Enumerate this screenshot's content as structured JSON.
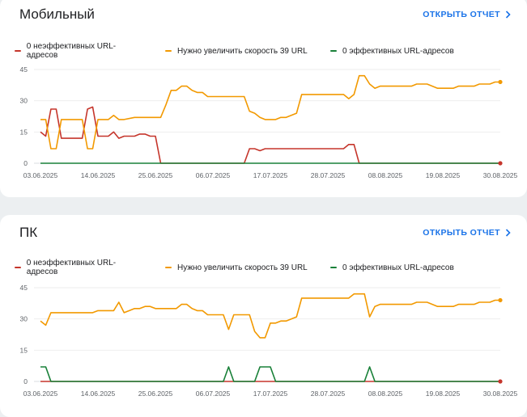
{
  "cards": [
    {
      "title": "Мобильный",
      "link_label": "ОТКРЫТЬ ОТЧЕТ",
      "legend": [
        {
          "label": "0 неэффективных URL-адресов",
          "color": "#c5352b"
        },
        {
          "label": "Нужно увеличить скорость 39 URL",
          "color": "#f29900"
        },
        {
          "label": "0 эффективных URL-адресов",
          "color": "#188038"
        }
      ]
    },
    {
      "title": "ПК",
      "link_label": "ОТКРЫТЬ ОТЧЕТ",
      "legend": [
        {
          "label": "0 неэффективных URL-адресов",
          "color": "#c5352b"
        },
        {
          "label": "Нужно увеличить скорость 39 URL",
          "color": "#f29900"
        },
        {
          "label": "0 эффективных URL-адресов",
          "color": "#188038"
        }
      ]
    }
  ],
  "chart_data": [
    {
      "type": "line",
      "x_range": [
        "03.06.2025",
        "30.08.2025"
      ],
      "x_ticks": [
        "03.06.2025",
        "14.06.2025",
        "25.06.2025",
        "06.07.2025",
        "17.07.2025",
        "28.07.2025",
        "08.08.2025",
        "19.08.2025",
        "30.08.2025"
      ],
      "y_ticks": [
        0,
        15,
        30,
        45
      ],
      "ylim": [
        0,
        45
      ],
      "grid": true,
      "series": [
        {
          "name": "0 неэффективных URL-адресов",
          "color": "#c5352b",
          "points": [
            [
              "03.06.2025",
              15
            ],
            [
              "04.06.2025",
              13
            ],
            [
              "05.06.2025",
              26
            ],
            [
              "06.06.2025",
              26
            ],
            [
              "07.06.2025",
              12
            ],
            [
              "11.06.2025",
              12
            ],
            [
              "12.06.2025",
              26
            ],
            [
              "13.06.2025",
              27
            ],
            [
              "14.06.2025",
              13
            ],
            [
              "16.06.2025",
              13
            ],
            [
              "17.06.2025",
              15
            ],
            [
              "18.06.2025",
              12
            ],
            [
              "19.06.2025",
              13
            ],
            [
              "21.06.2025",
              13
            ],
            [
              "22.06.2025",
              14
            ],
            [
              "23.06.2025",
              14
            ],
            [
              "24.06.2025",
              13
            ],
            [
              "25.06.2025",
              13
            ],
            [
              "26.06.2025",
              0
            ],
            [
              "12.07.2025",
              0
            ],
            [
              "13.07.2025",
              7
            ],
            [
              "14.07.2025",
              7
            ],
            [
              "15.07.2025",
              6
            ],
            [
              "16.07.2025",
              7
            ],
            [
              "31.07.2025",
              7
            ],
            [
              "01.08.2025",
              9
            ],
            [
              "02.08.2025",
              9
            ],
            [
              "03.08.2025",
              0
            ],
            [
              "30.08.2025",
              0
            ]
          ]
        },
        {
          "name": "Нужно увеличить скорость 39 URL",
          "color": "#f29900",
          "points": [
            [
              "03.06.2025",
              21
            ],
            [
              "04.06.2025",
              21
            ],
            [
              "05.06.2025",
              7
            ],
            [
              "06.06.2025",
              7
            ],
            [
              "07.06.2025",
              21
            ],
            [
              "11.06.2025",
              21
            ],
            [
              "12.06.2025",
              7
            ],
            [
              "13.06.2025",
              7
            ],
            [
              "14.06.2025",
              21
            ],
            [
              "16.06.2025",
              21
            ],
            [
              "17.06.2025",
              23
            ],
            [
              "18.06.2025",
              21
            ],
            [
              "19.06.2025",
              21
            ],
            [
              "21.06.2025",
              22
            ],
            [
              "25.06.2025",
              22
            ],
            [
              "26.06.2025",
              22
            ],
            [
              "27.06.2025",
              28
            ],
            [
              "28.06.2025",
              35
            ],
            [
              "29.06.2025",
              35
            ],
            [
              "30.06.2025",
              37
            ],
            [
              "01.07.2025",
              37
            ],
            [
              "02.07.2025",
              35
            ],
            [
              "03.07.2025",
              34
            ],
            [
              "04.07.2025",
              34
            ],
            [
              "05.07.2025",
              32
            ],
            [
              "12.07.2025",
              32
            ],
            [
              "13.07.2025",
              25
            ],
            [
              "14.07.2025",
              24
            ],
            [
              "15.07.2025",
              22
            ],
            [
              "16.07.2025",
              21
            ],
            [
              "18.07.2025",
              21
            ],
            [
              "19.07.2025",
              22
            ],
            [
              "20.07.2025",
              22
            ],
            [
              "22.07.2025",
              24
            ],
            [
              "23.07.2025",
              33
            ],
            [
              "31.07.2025",
              33
            ],
            [
              "01.08.2025",
              31
            ],
            [
              "02.08.2025",
              33
            ],
            [
              "03.08.2025",
              42
            ],
            [
              "04.08.2025",
              42
            ],
            [
              "05.08.2025",
              38
            ],
            [
              "06.08.2025",
              36
            ],
            [
              "07.08.2025",
              37
            ],
            [
              "13.08.2025",
              37
            ],
            [
              "14.08.2025",
              38
            ],
            [
              "16.08.2025",
              38
            ],
            [
              "18.08.2025",
              36
            ],
            [
              "21.08.2025",
              36
            ],
            [
              "22.08.2025",
              37
            ],
            [
              "25.08.2025",
              37
            ],
            [
              "26.08.2025",
              38
            ],
            [
              "28.08.2025",
              38
            ],
            [
              "29.08.2025",
              39
            ],
            [
              "30.08.2025",
              39
            ]
          ]
        },
        {
          "name": "0 эффективных URL-адресов",
          "color": "#188038",
          "points": [
            [
              "03.06.2025",
              0
            ],
            [
              "30.08.2025",
              0
            ]
          ]
        }
      ]
    },
    {
      "type": "line",
      "x_range": [
        "03.06.2025",
        "30.08.2025"
      ],
      "x_ticks": [
        "03.06.2025",
        "14.06.2025",
        "25.06.2025",
        "06.07.2025",
        "17.07.2025",
        "28.07.2025",
        "08.08.2025",
        "19.08.2025",
        "30.08.2025"
      ],
      "y_ticks": [
        0,
        15,
        30,
        45
      ],
      "ylim": [
        0,
        45
      ],
      "grid": true,
      "series": [
        {
          "name": "0 неэффективных URL-адресов",
          "color": "#c5352b",
          "points": [
            [
              "03.06.2025",
              0
            ],
            [
              "30.08.2025",
              0
            ]
          ]
        },
        {
          "name": "Нужно увеличить скорость 39 URL",
          "color": "#f29900",
          "points": [
            [
              "03.06.2025",
              29
            ],
            [
              "04.06.2025",
              27
            ],
            [
              "05.06.2025",
              33
            ],
            [
              "13.06.2025",
              33
            ],
            [
              "14.06.2025",
              34
            ],
            [
              "17.06.2025",
              34
            ],
            [
              "18.06.2025",
              38
            ],
            [
              "19.06.2025",
              33
            ],
            [
              "20.06.2025",
              34
            ],
            [
              "21.06.2025",
              35
            ],
            [
              "22.06.2025",
              35
            ],
            [
              "23.06.2025",
              36
            ],
            [
              "24.06.2025",
              36
            ],
            [
              "25.06.2025",
              35
            ],
            [
              "29.06.2025",
              35
            ],
            [
              "30.06.2025",
              37
            ],
            [
              "01.07.2025",
              37
            ],
            [
              "02.07.2025",
              35
            ],
            [
              "03.07.2025",
              34
            ],
            [
              "04.07.2025",
              34
            ],
            [
              "05.07.2025",
              32
            ],
            [
              "08.07.2025",
              32
            ],
            [
              "09.07.2025",
              25
            ],
            [
              "10.07.2025",
              32
            ],
            [
              "13.07.2025",
              32
            ],
            [
              "14.07.2025",
              24
            ],
            [
              "15.07.2025",
              21
            ],
            [
              "16.07.2025",
              21
            ],
            [
              "17.07.2025",
              28
            ],
            [
              "18.07.2025",
              28
            ],
            [
              "19.07.2025",
              29
            ],
            [
              "20.07.2025",
              29
            ],
            [
              "22.07.2025",
              31
            ],
            [
              "23.07.2025",
              40
            ],
            [
              "01.08.2025",
              40
            ],
            [
              "02.08.2025",
              42
            ],
            [
              "04.08.2025",
              42
            ],
            [
              "05.08.2025",
              31
            ],
            [
              "06.08.2025",
              36
            ],
            [
              "07.08.2025",
              37
            ],
            [
              "13.08.2025",
              37
            ],
            [
              "14.08.2025",
              38
            ],
            [
              "16.08.2025",
              38
            ],
            [
              "18.08.2025",
              36
            ],
            [
              "21.08.2025",
              36
            ],
            [
              "22.08.2025",
              37
            ],
            [
              "25.08.2025",
              37
            ],
            [
              "26.08.2025",
              38
            ],
            [
              "28.08.2025",
              38
            ],
            [
              "29.08.2025",
              39
            ],
            [
              "30.08.2025",
              39
            ]
          ]
        },
        {
          "name": "0 эффективных URL-адресов",
          "color": "#188038",
          "points": [
            [
              "03.06.2025",
              7
            ],
            [
              "04.06.2025",
              7
            ],
            [
              "05.06.2025",
              0
            ],
            [
              "08.07.2025",
              0
            ],
            [
              "09.07.2025",
              7
            ],
            [
              "10.07.2025",
              0
            ],
            [
              "14.07.2025",
              0
            ],
            [
              "15.07.2025",
              7
            ],
            [
              "17.07.2025",
              7
            ],
            [
              "18.07.2025",
              0
            ],
            [
              "04.08.2025",
              0
            ],
            [
              "05.08.2025",
              7
            ],
            [
              "06.08.2025",
              0
            ],
            [
              "30.08.2025",
              0
            ]
          ]
        }
      ]
    }
  ]
}
